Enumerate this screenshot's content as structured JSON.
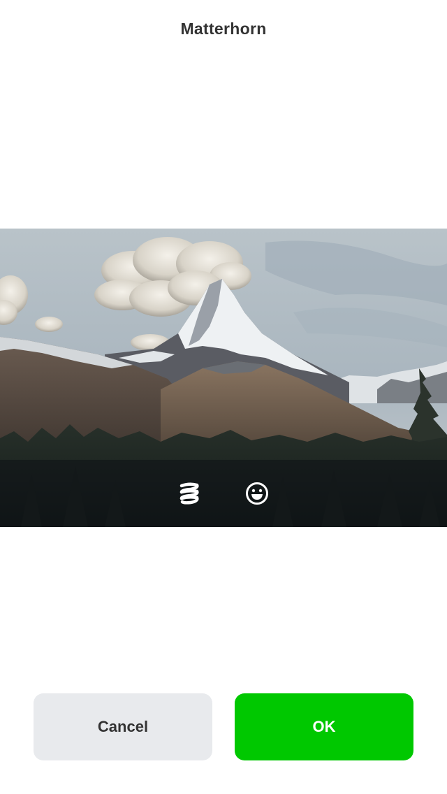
{
  "header": {
    "title": "Matterhorn"
  },
  "photo": {
    "subject": "Matterhorn"
  },
  "toolbar": {
    "icons": [
      "spring-effect-icon",
      "smiley-sticker-icon"
    ]
  },
  "actions": {
    "cancel_label": "Cancel",
    "ok_label": "OK"
  },
  "colors": {
    "ok_button": "#00c800",
    "cancel_button": "#e8eaed",
    "title_text": "#333333"
  }
}
